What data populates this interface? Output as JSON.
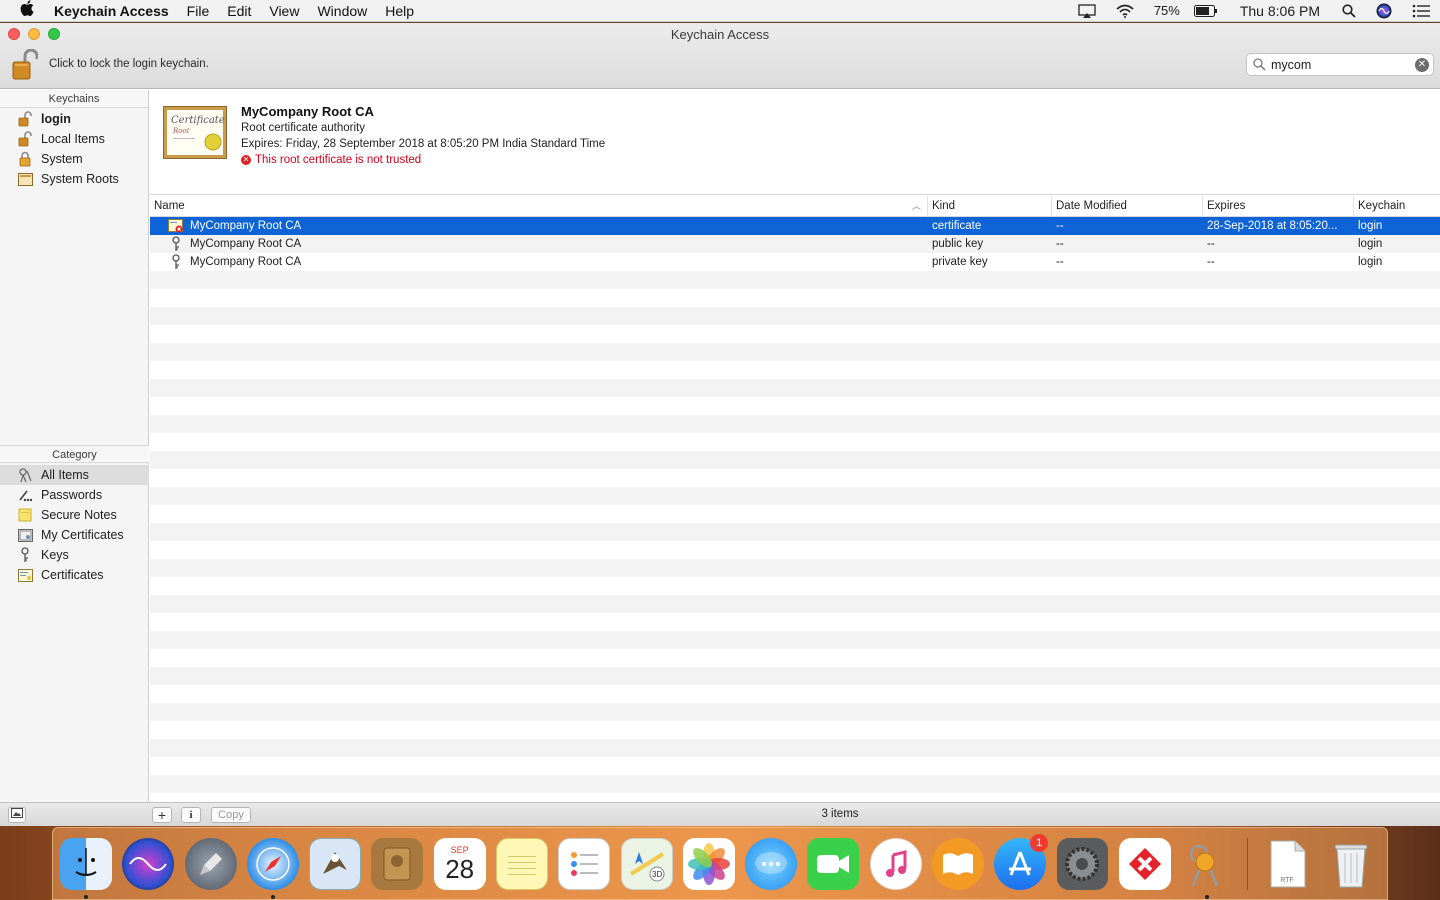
{
  "menubar": {
    "app_name": "Keychain Access",
    "menus": [
      "File",
      "Edit",
      "View",
      "Window",
      "Help"
    ],
    "battery": "75%",
    "clock": "Thu 8:06 PM"
  },
  "window": {
    "title": "Keychain Access",
    "lock_text": "Click to lock the login keychain.",
    "search_value": "mycom"
  },
  "sidebar": {
    "keychains_header": "Keychains",
    "keychains": [
      {
        "label": "login",
        "icon": "lock-open-icon"
      },
      {
        "label": "Local Items",
        "icon": "lock-open-icon"
      },
      {
        "label": "System",
        "icon": "lock-closed-icon"
      },
      {
        "label": "System Roots",
        "icon": "folder-icon"
      }
    ],
    "category_header": "Category",
    "categories": [
      {
        "label": "All Items",
        "icon": "all-items-icon"
      },
      {
        "label": "Passwords",
        "icon": "password-icon"
      },
      {
        "label": "Secure Notes",
        "icon": "note-icon"
      },
      {
        "label": "My Certificates",
        "icon": "my-certificate-icon"
      },
      {
        "label": "Keys",
        "icon": "key-icon"
      },
      {
        "label": "Certificates",
        "icon": "certificate-icon"
      }
    ]
  },
  "detail": {
    "title": "MyCompany Root CA",
    "subtitle": "Root certificate authority",
    "expires": "Expires: Friday, 28 September 2018 at 8:05:20 PM India Standard Time",
    "warning": "This root certificate is not trusted"
  },
  "table": {
    "columns": [
      "Name",
      "Kind",
      "Date Modified",
      "Expires",
      "Keychain"
    ],
    "rows": [
      {
        "name": "MyCompany Root CA",
        "kind": "certificate",
        "date_modified": "--",
        "expires": "28-Sep-2018 at 8:05:20...",
        "keychain": "login",
        "icon": "certificate-untrusted-icon"
      },
      {
        "name": "MyCompany Root CA",
        "kind": "public key",
        "date_modified": "--",
        "expires": "--",
        "keychain": "login",
        "icon": "key-icon"
      },
      {
        "name": "MyCompany Root CA",
        "kind": "private key",
        "date_modified": "--",
        "expires": "--",
        "keychain": "login",
        "icon": "key-icon"
      }
    ]
  },
  "bottombar": {
    "add_label": "+",
    "info_label": "i",
    "copy_label": "Copy",
    "count": "3 items"
  },
  "dock": {
    "calendar_month": "SEP",
    "calendar_day": "28",
    "appstore_badge": "1",
    "rtf_label": "RTF"
  }
}
